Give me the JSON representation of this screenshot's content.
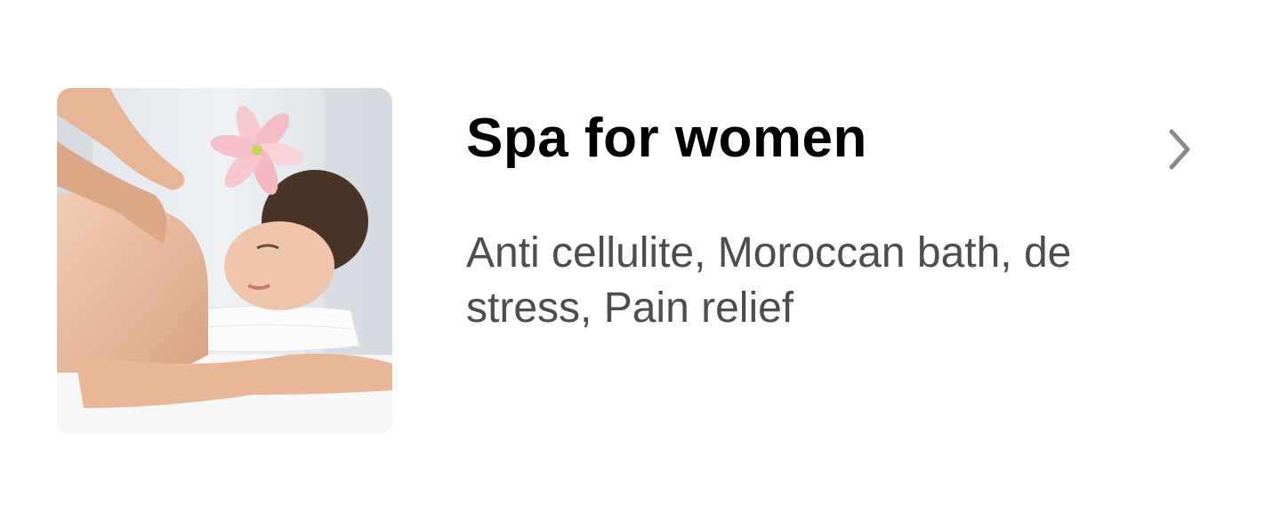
{
  "card": {
    "title": "Spa for women",
    "subtitle": "Anti cellulite, Moroccan bath, de stress, Pain relief",
    "image_icon": "spa-massage-photo",
    "chevron_icon": "chevron-right-icon"
  },
  "colors": {
    "background": "#ffffff",
    "title": "#000000",
    "subtitle": "#4d4d4d",
    "chevron": "#8a8a8a"
  }
}
